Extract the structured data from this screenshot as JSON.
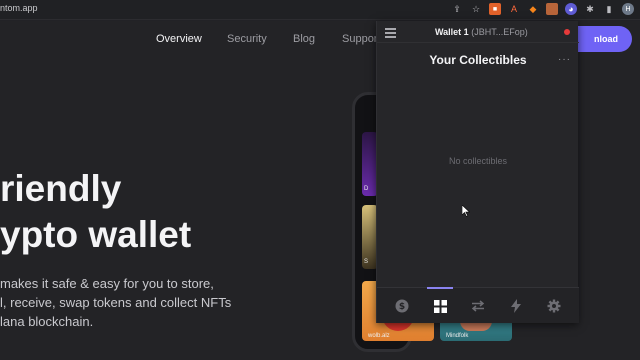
{
  "browser": {
    "url": "ntom.app",
    "extensions": [
      "share-icon",
      "star-icon",
      "ext-orange",
      "ext-a",
      "metamask-fox-icon",
      "ext-grid",
      "phantom-icon",
      "puzzle-icon",
      "sidebar-icon"
    ],
    "avatar_letter": "H"
  },
  "site": {
    "nav": {
      "overview": "Overview",
      "security": "Security",
      "blog": "Blog",
      "support": "Suppor",
      "download": "nload"
    },
    "hero_line1": "riendly",
    "hero_line2": "ypto wallet",
    "para_line1": "makes it safe & easy for you to store,",
    "para_line2": "l, receive, swap tokens and collect NFTs",
    "para_line3": "lana blockchain.",
    "card_caption_1": "D",
    "card_caption_2": "S",
    "card_caption_3": "wolb.alz",
    "card_caption_4": "Mindfolk"
  },
  "wallet": {
    "name": "Wallet 1",
    "address_short": "(JBHT...EFop)",
    "section_title": "Your Collectibles",
    "more": "···",
    "empty_message": "No collectibles",
    "status_color": "#e63a3a",
    "tabs": [
      {
        "name": "tab-wallet",
        "icon": "dollar-icon",
        "active": false
      },
      {
        "name": "tab-collectibles",
        "icon": "grid-icon",
        "active": true
      },
      {
        "name": "tab-swap",
        "icon": "swap-icon",
        "active": false
      },
      {
        "name": "tab-activity",
        "icon": "lightning-icon",
        "active": false
      },
      {
        "name": "tab-settings",
        "icon": "gear-icon",
        "active": false
      }
    ]
  },
  "colors": {
    "accent": "#6f63f5",
    "background": "#232326",
    "popup": "#262629"
  }
}
